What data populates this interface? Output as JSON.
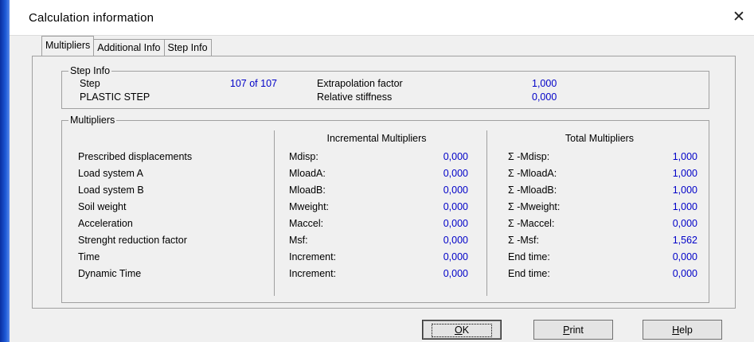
{
  "window": {
    "title": "Calculation information",
    "close_glyph": "✕"
  },
  "tabs": [
    {
      "label": "Multipliers",
      "active": true
    },
    {
      "label": "Additional Info",
      "active": false
    },
    {
      "label": "Step Info",
      "active": false
    }
  ],
  "step_info": {
    "legend": "Step Info",
    "step_label": "Step",
    "step_value": "107 of 107",
    "plastic_step": "PLASTIC STEP",
    "extrapolation_label": "Extrapolation factor",
    "extrapolation_value": "1,000",
    "relative_stiffness_label": "Relative stiffness",
    "relative_stiffness_value": "0,000"
  },
  "multipliers": {
    "legend": "Multipliers",
    "incremental_header": "Incremental Multipliers",
    "total_header": "Total Multipliers",
    "rows": [
      {
        "label": "Prescribed displacements",
        "inc_name": "Mdisp:",
        "inc_value": "0,000",
        "tot_name": "Σ -Mdisp:",
        "tot_value": "1,000"
      },
      {
        "label": "Load system A",
        "inc_name": "MloadA:",
        "inc_value": "0,000",
        "tot_name": "Σ -MloadA:",
        "tot_value": "1,000"
      },
      {
        "label": "Load system B",
        "inc_name": "MloadB:",
        "inc_value": "0,000",
        "tot_name": "Σ -MloadB:",
        "tot_value": "1,000"
      },
      {
        "label": "Soil weight",
        "inc_name": "Mweight:",
        "inc_value": "0,000",
        "tot_name": "Σ -Mweight:",
        "tot_value": "1,000"
      },
      {
        "label": "Acceleration",
        "inc_name": "Maccel:",
        "inc_value": "0,000",
        "tot_name": "Σ -Maccel:",
        "tot_value": "0,000"
      },
      {
        "label": "Strenght reduction factor",
        "inc_name": "Msf:",
        "inc_value": "0,000",
        "tot_name": "Σ -Msf:",
        "tot_value": "1,562"
      },
      {
        "label": "Time",
        "inc_name": "Increment:",
        "inc_value": "0,000",
        "tot_name": "End time:",
        "tot_value": "0,000"
      },
      {
        "label": "Dynamic Time",
        "inc_name": "Increment:",
        "inc_value": "0,000",
        "tot_name": "End time:",
        "tot_value": "0,000"
      }
    ]
  },
  "buttons": {
    "ok": {
      "underline": "O",
      "rest": "K"
    },
    "print": {
      "underline": "P",
      "rest": "rint"
    },
    "help": {
      "underline": "H",
      "rest": "elp"
    }
  },
  "colors": {
    "value_blue": "#0000c8",
    "dialog_bg": "#f0f0f0"
  }
}
